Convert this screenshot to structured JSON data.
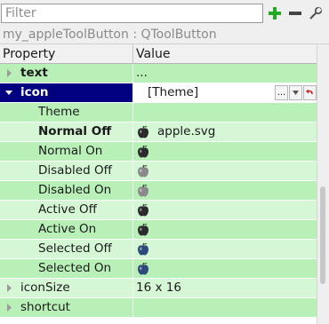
{
  "filter": {
    "placeholder": "Filter"
  },
  "toolbar": {
    "add_icon": "plus-icon",
    "remove_icon": "minus-icon",
    "config_icon": "wrench-icon"
  },
  "object_line": "my_appleToolButton : QToolButton",
  "columns": {
    "property": "Property",
    "value": "Value"
  },
  "colors": {
    "row_green_light": "#d5f7d5",
    "row_green_dark": "#b8f0b8",
    "selection": "#000080",
    "plus_green": "#22aa22",
    "reset_red": "#d02020"
  },
  "rows": [
    {
      "label": "text",
      "value": "...",
      "bold": true,
      "expander": "collapsed",
      "indent": 1
    },
    {
      "label": "icon",
      "value": "[Theme]",
      "bold": true,
      "expander": "expanded",
      "indent": 1,
      "selected": true
    },
    {
      "label": "Theme",
      "value": "",
      "indent": 2
    },
    {
      "label": "Normal Off",
      "value": "apple.svg",
      "bold": true,
      "indent": 2,
      "apple": "dark"
    },
    {
      "label": "Normal On",
      "value": "",
      "indent": 2,
      "apple": "dark"
    },
    {
      "label": "Disabled Off",
      "value": "",
      "indent": 2,
      "apple": "gray"
    },
    {
      "label": "Disabled On",
      "value": "",
      "indent": 2,
      "apple": "gray"
    },
    {
      "label": "Active Off",
      "value": "",
      "indent": 2,
      "apple": "dark"
    },
    {
      "label": "Active On",
      "value": "",
      "indent": 2,
      "apple": "dark"
    },
    {
      "label": "Selected Off",
      "value": "",
      "indent": 2,
      "apple": "blue"
    },
    {
      "label": "Selected On",
      "value": "",
      "indent": 2,
      "apple": "blue"
    },
    {
      "label": "iconSize",
      "value": "16 x 16",
      "indent": 1,
      "expander": "collapsed"
    },
    {
      "label": "shortcut",
      "value": "",
      "indent": 1,
      "expander": "collapsed"
    }
  ]
}
